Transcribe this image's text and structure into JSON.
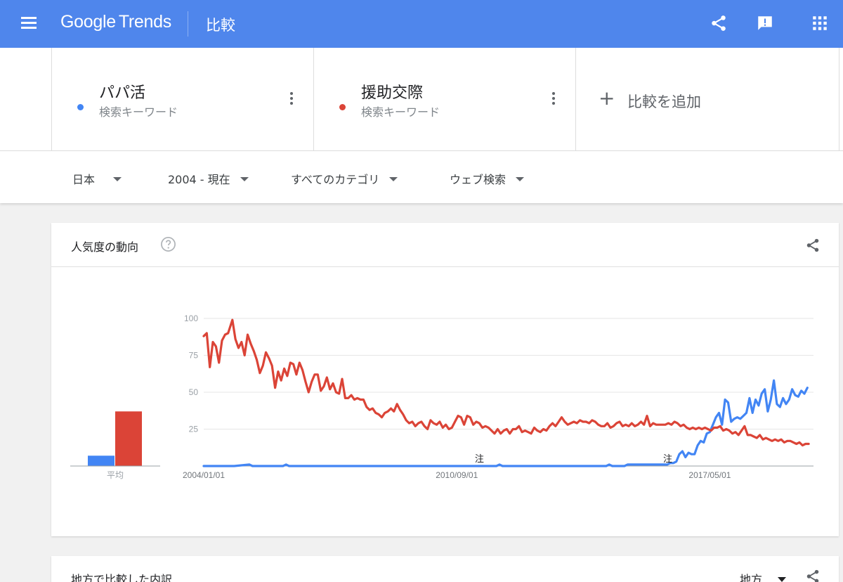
{
  "header": {
    "logo_google": "Google",
    "logo_trends": "Trends",
    "page_title": "比較"
  },
  "terms": [
    {
      "name": "パパ活",
      "type": "検索キーワード",
      "color": "#4285f4"
    },
    {
      "name": "援助交際",
      "type": "検索キーワード",
      "color": "#db4437"
    }
  ],
  "add_compare_label": "比較を追加",
  "filters": {
    "geo": "日本",
    "time": "2004 - 現在",
    "category": "すべてのカテゴリ",
    "property": "ウェブ検索"
  },
  "interest_card": {
    "title": "人気度の動向"
  },
  "region_card": {
    "title": "地方で比較した内訳",
    "resolution": "地方"
  },
  "chart_data": {
    "type": "line",
    "y_ticks": [
      "100",
      "75",
      "50",
      "25"
    ],
    "ylim": [
      0,
      100
    ],
    "x_ticks": [
      "2004/01/01",
      "2010/09/01",
      "2017/05/01"
    ],
    "notes": [
      {
        "label": "注",
        "at": 0.452
      },
      {
        "label": "注",
        "at": 0.761
      }
    ],
    "average": {
      "label": "平均",
      "values": [
        7,
        37
      ]
    },
    "series": [
      {
        "key": "term0",
        "color": "#4285f4",
        "points": [
          [
            0.0,
            0
          ],
          [
            0.05,
            0
          ],
          [
            0.075,
            1
          ],
          [
            0.08,
            0
          ],
          [
            0.13,
            0
          ],
          [
            0.135,
            1
          ],
          [
            0.14,
            0
          ],
          [
            0.48,
            0
          ],
          [
            0.485,
            1
          ],
          [
            0.49,
            0
          ],
          [
            0.66,
            0
          ],
          [
            0.665,
            1
          ],
          [
            0.67,
            0
          ],
          [
            0.69,
            0
          ],
          [
            0.695,
            1
          ],
          [
            0.72,
            1
          ],
          [
            0.74,
            1
          ],
          [
            0.76,
            1
          ],
          [
            0.765,
            2
          ],
          [
            0.77,
            2
          ],
          [
            0.775,
            3
          ],
          [
            0.78,
            8
          ],
          [
            0.785,
            10
          ],
          [
            0.79,
            6
          ],
          [
            0.795,
            9
          ],
          [
            0.8,
            8
          ],
          [
            0.805,
            8
          ],
          [
            0.81,
            14
          ],
          [
            0.815,
            17
          ],
          [
            0.82,
            16
          ],
          [
            0.825,
            22
          ],
          [
            0.83,
            23
          ],
          [
            0.835,
            28
          ],
          [
            0.84,
            33
          ],
          [
            0.845,
            36
          ],
          [
            0.85,
            28
          ],
          [
            0.855,
            45
          ],
          [
            0.86,
            43
          ],
          [
            0.865,
            30
          ],
          [
            0.87,
            32
          ],
          [
            0.875,
            33
          ],
          [
            0.88,
            32
          ],
          [
            0.885,
            34
          ],
          [
            0.89,
            36
          ],
          [
            0.895,
            46
          ],
          [
            0.9,
            36
          ],
          [
            0.905,
            45
          ],
          [
            0.91,
            41
          ],
          [
            0.915,
            49
          ],
          [
            0.92,
            52
          ],
          [
            0.925,
            37
          ],
          [
            0.93,
            45
          ],
          [
            0.935,
            58
          ],
          [
            0.94,
            42
          ],
          [
            0.945,
            40
          ],
          [
            0.95,
            46
          ],
          [
            0.955,
            42
          ],
          [
            0.96,
            45
          ],
          [
            0.965,
            52
          ],
          [
            0.97,
            48
          ],
          [
            0.975,
            47
          ],
          [
            0.98,
            51
          ],
          [
            0.985,
            49
          ],
          [
            0.99,
            53
          ]
        ]
      },
      {
        "key": "term1",
        "color": "#db4437",
        "points": [
          [
            0.0,
            88
          ],
          [
            0.005,
            90
          ],
          [
            0.01,
            67
          ],
          [
            0.015,
            84
          ],
          [
            0.02,
            81
          ],
          [
            0.025,
            70
          ],
          [
            0.03,
            85
          ],
          [
            0.035,
            89
          ],
          [
            0.04,
            90
          ],
          [
            0.047,
            99
          ],
          [
            0.052,
            86
          ],
          [
            0.057,
            80
          ],
          [
            0.062,
            84
          ],
          [
            0.067,
            75
          ],
          [
            0.072,
            89
          ],
          [
            0.077,
            83
          ],
          [
            0.082,
            78
          ],
          [
            0.087,
            72
          ],
          [
            0.092,
            63
          ],
          [
            0.097,
            68
          ],
          [
            0.102,
            77
          ],
          [
            0.107,
            73
          ],
          [
            0.112,
            68
          ],
          [
            0.117,
            53
          ],
          [
            0.122,
            64
          ],
          [
            0.127,
            58
          ],
          [
            0.132,
            66
          ],
          [
            0.137,
            61
          ],
          [
            0.142,
            70
          ],
          [
            0.147,
            69
          ],
          [
            0.152,
            62
          ],
          [
            0.157,
            70
          ],
          [
            0.162,
            65
          ],
          [
            0.167,
            57
          ],
          [
            0.172,
            50
          ],
          [
            0.177,
            57
          ],
          [
            0.182,
            62
          ],
          [
            0.187,
            62
          ],
          [
            0.192,
            51
          ],
          [
            0.197,
            54
          ],
          [
            0.202,
            60
          ],
          [
            0.207,
            52
          ],
          [
            0.212,
            56
          ],
          [
            0.217,
            50
          ],
          [
            0.222,
            49
          ],
          [
            0.227,
            59
          ],
          [
            0.232,
            46
          ],
          [
            0.237,
            46
          ],
          [
            0.242,
            48
          ],
          [
            0.247,
            45
          ],
          [
            0.252,
            46
          ],
          [
            0.257,
            45
          ],
          [
            0.262,
            45
          ],
          [
            0.267,
            40
          ],
          [
            0.272,
            38
          ],
          [
            0.277,
            39
          ],
          [
            0.282,
            36
          ],
          [
            0.287,
            35
          ],
          [
            0.292,
            33
          ],
          [
            0.297,
            36
          ],
          [
            0.302,
            37
          ],
          [
            0.307,
            39
          ],
          [
            0.312,
            37
          ],
          [
            0.317,
            42
          ],
          [
            0.322,
            38
          ],
          [
            0.327,
            35
          ],
          [
            0.332,
            31
          ],
          [
            0.337,
            29
          ],
          [
            0.342,
            30
          ],
          [
            0.347,
            27
          ],
          [
            0.352,
            29
          ],
          [
            0.357,
            30
          ],
          [
            0.362,
            27
          ],
          [
            0.367,
            25
          ],
          [
            0.372,
            31
          ],
          [
            0.377,
            29
          ],
          [
            0.382,
            28
          ],
          [
            0.387,
            30
          ],
          [
            0.392,
            26
          ],
          [
            0.397,
            28
          ],
          [
            0.402,
            25
          ],
          [
            0.407,
            26
          ],
          [
            0.412,
            30
          ],
          [
            0.417,
            34
          ],
          [
            0.422,
            33
          ],
          [
            0.427,
            28
          ],
          [
            0.432,
            34
          ],
          [
            0.437,
            33
          ],
          [
            0.442,
            28
          ],
          [
            0.447,
            30
          ],
          [
            0.452,
            29
          ],
          [
            0.457,
            26
          ],
          [
            0.462,
            27
          ],
          [
            0.467,
            26
          ],
          [
            0.472,
            24
          ],
          [
            0.477,
            22
          ],
          [
            0.482,
            25
          ],
          [
            0.487,
            22
          ],
          [
            0.492,
            24
          ],
          [
            0.497,
            25
          ],
          [
            0.502,
            22
          ],
          [
            0.507,
            25
          ],
          [
            0.512,
            25
          ],
          [
            0.517,
            27
          ],
          [
            0.522,
            23
          ],
          [
            0.527,
            24
          ],
          [
            0.532,
            23
          ],
          [
            0.537,
            22
          ],
          [
            0.542,
            26
          ],
          [
            0.547,
            24
          ],
          [
            0.552,
            23
          ],
          [
            0.557,
            25
          ],
          [
            0.562,
            24
          ],
          [
            0.567,
            27
          ],
          [
            0.572,
            29
          ],
          [
            0.577,
            27
          ],
          [
            0.582,
            30
          ],
          [
            0.587,
            33
          ],
          [
            0.592,
            30
          ],
          [
            0.597,
            28
          ],
          [
            0.602,
            29
          ],
          [
            0.607,
            30
          ],
          [
            0.612,
            29
          ],
          [
            0.617,
            31
          ],
          [
            0.622,
            30
          ],
          [
            0.627,
            30
          ],
          [
            0.632,
            29
          ],
          [
            0.637,
            31
          ],
          [
            0.642,
            30
          ],
          [
            0.647,
            28
          ],
          [
            0.652,
            27
          ],
          [
            0.657,
            27
          ],
          [
            0.662,
            29
          ],
          [
            0.667,
            26
          ],
          [
            0.672,
            27
          ],
          [
            0.677,
            29
          ],
          [
            0.682,
            30
          ],
          [
            0.687,
            27
          ],
          [
            0.692,
            28
          ],
          [
            0.697,
            27
          ],
          [
            0.702,
            29
          ],
          [
            0.707,
            27
          ],
          [
            0.712,
            28
          ],
          [
            0.717,
            30
          ],
          [
            0.722,
            28
          ],
          [
            0.727,
            34
          ],
          [
            0.732,
            27
          ],
          [
            0.737,
            29
          ],
          [
            0.742,
            28
          ],
          [
            0.747,
            28
          ],
          [
            0.752,
            28
          ],
          [
            0.757,
            28
          ],
          [
            0.762,
            29
          ],
          [
            0.767,
            28
          ],
          [
            0.772,
            30
          ],
          [
            0.777,
            29
          ],
          [
            0.782,
            27
          ],
          [
            0.787,
            28
          ],
          [
            0.792,
            26
          ],
          [
            0.797,
            25
          ],
          [
            0.802,
            26
          ],
          [
            0.807,
            25
          ],
          [
            0.812,
            26
          ],
          [
            0.817,
            25
          ],
          [
            0.822,
            26
          ],
          [
            0.827,
            25
          ],
          [
            0.832,
            24
          ],
          [
            0.837,
            26
          ],
          [
            0.842,
            26
          ],
          [
            0.847,
            27
          ],
          [
            0.852,
            24
          ],
          [
            0.857,
            25
          ],
          [
            0.862,
            24
          ],
          [
            0.867,
            22
          ],
          [
            0.872,
            23
          ],
          [
            0.877,
            21
          ],
          [
            0.882,
            24
          ],
          [
            0.887,
            27
          ],
          [
            0.892,
            21
          ],
          [
            0.897,
            21
          ],
          [
            0.902,
            20
          ],
          [
            0.907,
            19
          ],
          [
            0.912,
            21
          ],
          [
            0.917,
            18
          ],
          [
            0.922,
            19
          ],
          [
            0.927,
            18
          ],
          [
            0.932,
            17
          ],
          [
            0.937,
            18
          ],
          [
            0.942,
            17
          ],
          [
            0.947,
            18
          ],
          [
            0.952,
            16
          ],
          [
            0.957,
            17
          ],
          [
            0.962,
            17
          ],
          [
            0.967,
            16
          ],
          [
            0.972,
            15
          ],
          [
            0.977,
            16
          ],
          [
            0.982,
            14
          ],
          [
            0.987,
            15
          ],
          [
            0.992,
            15
          ]
        ]
      }
    ]
  }
}
